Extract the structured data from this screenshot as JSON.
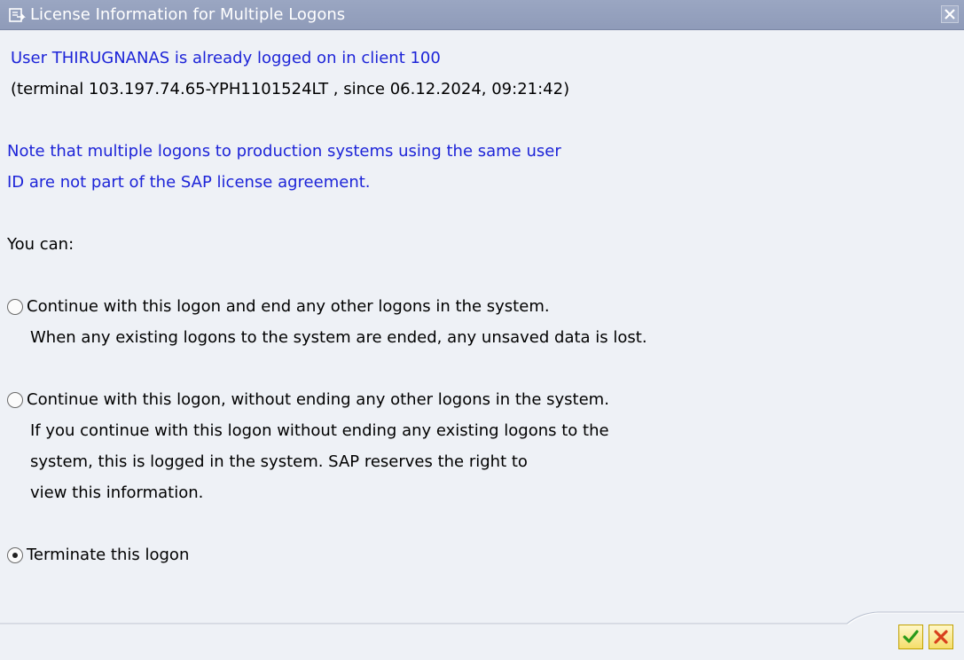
{
  "window": {
    "title": "License Information for Multiple Logons",
    "title_icon": "dialog-icon",
    "close_icon": "close-icon"
  },
  "message": {
    "user_line": "User THIRUGNANAS is already logged on in client 100",
    "terminal_line": "(terminal 103.197.74.65-YPH1101524LT , since 06.12.2024, 09:21:42)",
    "note_line1": "Note that multiple logons to production systems using the same user",
    "note_line2": "ID are not part of the SAP license agreement.",
    "you_can": "You can:"
  },
  "options": [
    {
      "label": "Continue with this logon and end any other logons in the system.",
      "details": [
        "When any existing logons to the system are ended, any unsaved data is lost."
      ],
      "selected": false
    },
    {
      "label": "Continue with this logon, without ending any other logons in the system.",
      "details": [
        "If you continue with this logon without ending any existing logons to the",
        "system, this is logged in the system. SAP reserves the right to",
        "view this information."
      ],
      "selected": false
    },
    {
      "label": "Terminate this logon",
      "details": [],
      "selected": true
    }
  ],
  "footer": {
    "confirm_icon": "checkmark-icon",
    "cancel_icon": "cancel-x-icon"
  },
  "colors": {
    "titlebar": "#949fbd",
    "background": "#eef1f6",
    "message_blue": "#1d24d8",
    "confirm_green": "#2a9a1a",
    "cancel_red": "#d8401c"
  }
}
